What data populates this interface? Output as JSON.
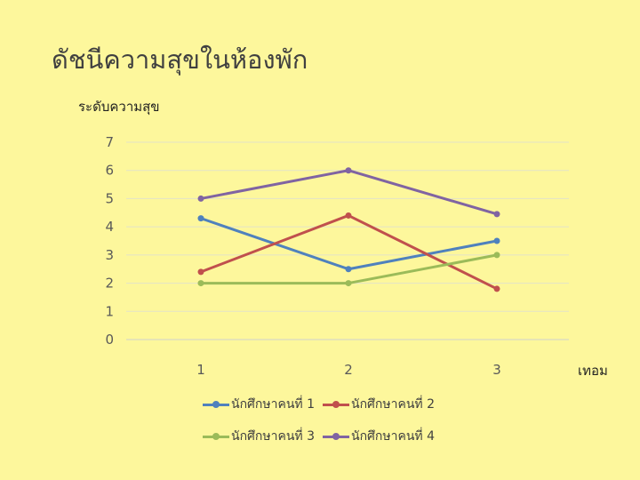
{
  "chart_data": {
    "type": "line",
    "title": "ดัชนีความสุขในห้องพัก",
    "ylabel": "ระดับความสุข",
    "xlabel": "เทอม",
    "categories": [
      "1",
      "2",
      "3"
    ],
    "ylim": [
      0,
      7
    ],
    "yticks": [
      "0",
      "1",
      "2",
      "3",
      "4",
      "5",
      "6",
      "7"
    ],
    "grid": true,
    "legend_position": "bottom",
    "series": [
      {
        "name": "นักศึกษาคนที่ 1",
        "color": "#4f81bd",
        "values": [
          4.3,
          2.5,
          3.5
        ]
      },
      {
        "name": "นักศึกษาคนที่ 2",
        "color": "#c0504d",
        "values": [
          2.4,
          4.4,
          1.8
        ]
      },
      {
        "name": "นักศึกษาคนที่ 3",
        "color": "#9bbb59",
        "values": [
          2.0,
          2.0,
          3.0
        ]
      },
      {
        "name": "นักศึกษาคนที่ 4",
        "color": "#8064a2",
        "values": [
          5.0,
          6.0,
          4.45
        ]
      }
    ]
  }
}
